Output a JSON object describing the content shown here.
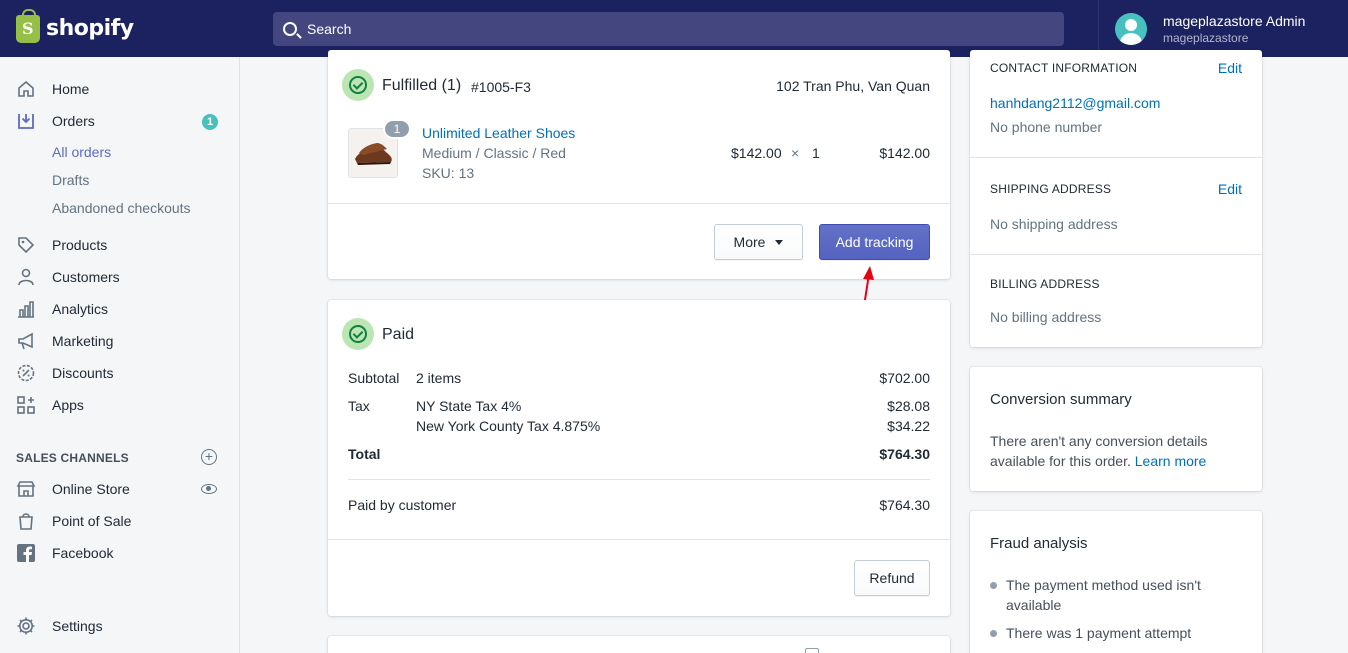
{
  "topbar": {
    "brand": "shopify",
    "search_placeholder": "Search",
    "user_name": "mageplazastore Admin",
    "user_store": "mageplazastore"
  },
  "sidebar": {
    "home": "Home",
    "orders": "Orders",
    "orders_badge": "1",
    "all_orders": "All orders",
    "drafts": "Drafts",
    "abandoned": "Abandoned checkouts",
    "products": "Products",
    "customers": "Customers",
    "analytics": "Analytics",
    "marketing": "Marketing",
    "discounts": "Discounts",
    "apps": "Apps",
    "sales_channels": "SALES CHANNELS",
    "online_store": "Online Store",
    "pos": "Point of Sale",
    "facebook": "Facebook",
    "settings": "Settings"
  },
  "fulfilled": {
    "title": "Fulfilled",
    "count": "(1)",
    "order_id": "#1005-F3",
    "address": "102 Tran Phu, Van Quan",
    "item": {
      "qty_badge": "1",
      "name": "Unlimited Leather Shoes",
      "variant": "Medium / Classic / Red",
      "sku": "SKU: 13",
      "price": "$142.00",
      "times": "×",
      "qty": "1",
      "total": "$142.00"
    },
    "more_button": "More",
    "tracking_button": "Add tracking"
  },
  "paid": {
    "title": "Paid",
    "subtotal_label": "Subtotal",
    "subtotal_items": "2 items",
    "subtotal_value": "$702.00",
    "tax_label": "Tax",
    "tax1_name": "NY State Tax 4%",
    "tax1_value": "$28.08",
    "tax2_name": "New York County Tax 4.875%",
    "tax2_value": "$34.22",
    "total_label": "Total",
    "total_value": "$764.30",
    "paid_by_label": "Paid by customer",
    "paid_by_value": "$764.30",
    "refund_button": "Refund"
  },
  "customer_card": {
    "contact_title": "CONTACT INFORMATION",
    "edit": "Edit",
    "email": "hanhdang2112@gmail.com",
    "phone": "No phone number",
    "shipping_title": "SHIPPING ADDRESS",
    "shipping_value": "No shipping address",
    "billing_title": "BILLING ADDRESS",
    "billing_value": "No billing address"
  },
  "conversion": {
    "title": "Conversion summary",
    "line1": "There aren't any conversion details",
    "line2": "available for this order.",
    "learn_more": "Learn more"
  },
  "fraud": {
    "title": "Fraud analysis",
    "item1_line1": "The payment method used isn't",
    "item1_line2": "available",
    "item2": "There was 1 payment attempt"
  },
  "colors": {
    "topbar": "#1c2260",
    "accent": "#5c6ac4",
    "link": "#006fbb",
    "success": "#108043",
    "annotation_arrow": "#e60012"
  }
}
